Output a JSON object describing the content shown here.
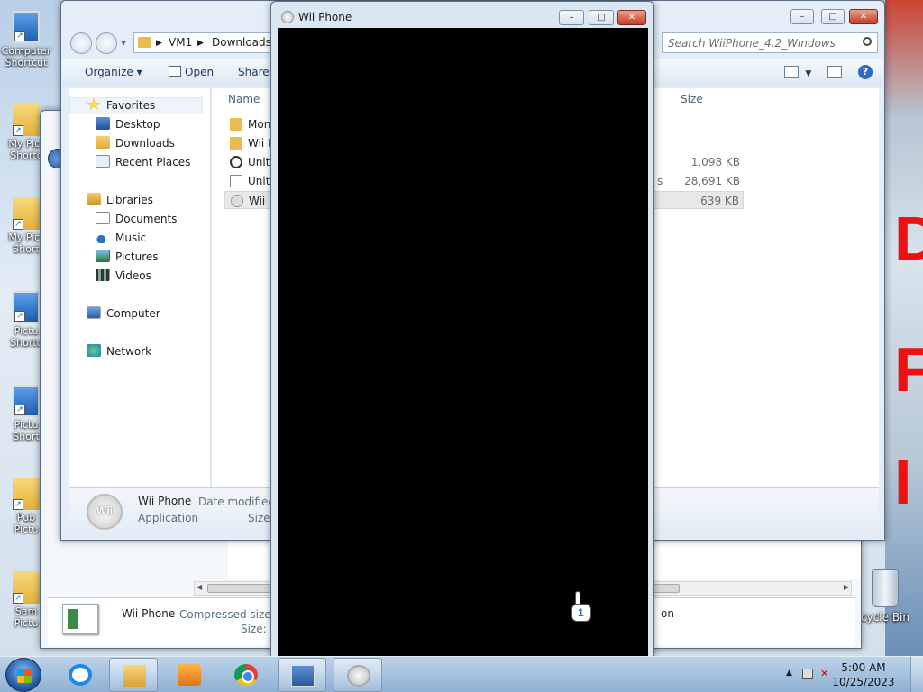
{
  "desktop": {
    "icons": [
      {
        "line1": "Computer",
        "line2": "Shortcut"
      },
      {
        "line1": "My Pict",
        "line2": "Shortc"
      },
      {
        "line1": "My Pict",
        "line2": "Short"
      },
      {
        "line1": "Pictu",
        "line2": "Shortc"
      },
      {
        "line1": "Pictu",
        "line2": "Short"
      },
      {
        "line1": "Pub",
        "line2": "Pictu"
      },
      {
        "line1": "Sam",
        "line2": "Pictu"
      }
    ],
    "recycle_label": "cycle Bin",
    "wallpaper_letters": [
      "D",
      "F",
      "I"
    ]
  },
  "explorer_back": {
    "details_name": "Wii Phone",
    "compressed_label": "Compressed size: 11",
    "size_label": "Size: 63",
    "partial_text": "on"
  },
  "explorer": {
    "caption": {
      "minimize": "–",
      "maximize": "□",
      "close": "✕"
    },
    "breadcrumb": [
      "VM1",
      "Downloads"
    ],
    "search_placeholder": "Search WiiPhone_4.2_Windows",
    "toolbar": {
      "organize": "Organize ▾",
      "open": "Open",
      "share": "Share w"
    },
    "nav": {
      "favorites": "Favorites",
      "desktop": "Desktop",
      "downloads": "Downloads",
      "recent": "Recent Places",
      "libraries": "Libraries",
      "documents": "Documents",
      "music": "Music",
      "pictures": "Pictures",
      "videos": "Videos",
      "computer": "Computer",
      "network": "Network"
    },
    "columns": {
      "name": "Name",
      "size": "Size"
    },
    "files": [
      {
        "name": "Mono",
        "type": "",
        "size": ""
      },
      {
        "name": "Wii P",
        "type": "",
        "size": ""
      },
      {
        "name": "Unity",
        "type": "",
        "size": "1,098 KB"
      },
      {
        "name": "Unity",
        "type": "s",
        "size": "28,691 KB"
      },
      {
        "name": "Wii P",
        "type": "",
        "size": "639 KB"
      }
    ],
    "details": {
      "logo_text": "Wii",
      "name": "Wii Phone",
      "type": "Application",
      "modified_label": "Date modified:",
      "size_label": "Size:"
    }
  },
  "wii_window": {
    "title": "Wii Phone",
    "cursor_number": "1"
  },
  "taskbar": {
    "time": "5:00 AM",
    "date": "10/25/2023"
  }
}
